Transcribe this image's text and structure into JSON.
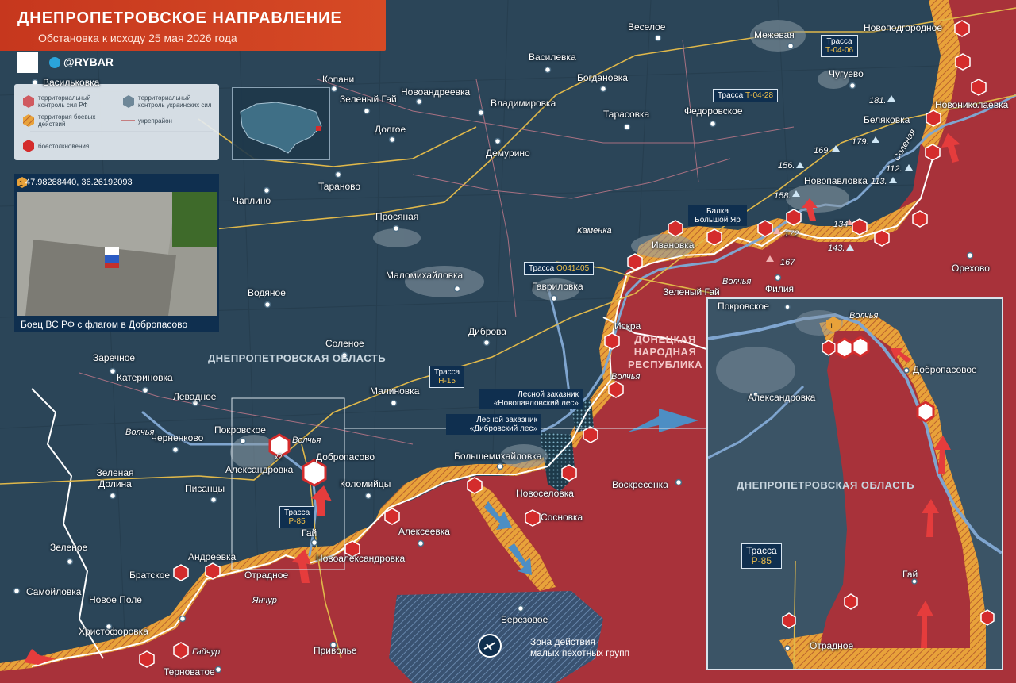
{
  "header": {
    "title": "ДНЕПРОПЕТРОВСКОЕ НАПРАВЛЕНИЕ",
    "subtitle": "Обстановка к исходу 25 мая 2026 года",
    "brand": "@RYBAR"
  },
  "legend": {
    "ru_control": "территориальный контроль сил РФ",
    "ua_control": "территориальный контроль украинских сил",
    "combat_zone": "территория боевых действий",
    "fortified_area": "укрепрайон",
    "clashes": "боестолкновения"
  },
  "photo": {
    "badge": "1",
    "coordinates": "47.98288440, 36.26192093",
    "caption": "Боец ВС РФ с флагом в Добропасово"
  },
  "regions": {
    "dnepr": "ДНЕПРОПЕТРОВСКАЯ ОБЛАСТЬ",
    "dnr": "ДОНЕЦКАЯ НАРОДНАЯ РЕСПУБЛИКА",
    "inset_dnepr": "ДНЕПРОПЕТРОВСКАЯ ОБЛАСТЬ"
  },
  "highways": {
    "t0406": {
      "label": "Трасса",
      "num": "Т-04-06"
    },
    "t0428": {
      "label": "Трасса",
      "num": "Т-04-28"
    },
    "o041405": {
      "label": "Трасса",
      "num": "О041405"
    },
    "h15": {
      "label": "Трасса",
      "num": "Н-15"
    },
    "p85": {
      "label": "Трасса",
      "num": "Р-85"
    },
    "inset_p85": {
      "label": "Трасса",
      "num": "Р-85"
    }
  },
  "tags": {
    "balka": "Балка Большой Яр",
    "forest1": "Лесной заказник «Новопавловский лес»",
    "forest2": "Лесной заказник «Дибровский лес»"
  },
  "zone": {
    "line1": "Зона действия",
    "line2": "малых пехотных групп"
  },
  "multiplier": "x2",
  "rivers": {
    "volchya": "Волчья",
    "kamenka": "Каменка",
    "solenaya": "Соленая",
    "yanchur": "Янчур",
    "gaichur": "Гайчур"
  },
  "heights": [
    "181.",
    "179.",
    "169.",
    "156.",
    "158.",
    "112.",
    "113.",
    "172",
    "134",
    "143.",
    "167"
  ],
  "settlements": {
    "vasilkovka": "Васильковка",
    "kopani": "Копани",
    "zeleny_gai1": "Зеленый Гай",
    "novoandreevka": "Новоандреевка",
    "vladimirovka": "Владимировка",
    "vasilevka": "Василевка",
    "veseloe": "Веселое",
    "bogdanovka": "Богдановка",
    "mezhevaya": "Межевая",
    "novopodgorodnoe": "Новоподгородное",
    "chugueve": "Чугуево",
    "dolgoe": "Долгое",
    "tarasovka": "Тарасовка",
    "fedorovskoe": "Федоровское",
    "novonikolaevka": "Новониколаевка",
    "belyakovka": "Беляковка",
    "demurino": "Демурино",
    "taranovo": "Тараново",
    "novopavlovka": "Новопавловка",
    "chaplino": "Чаплино",
    "prosyanaya": "Просяная",
    "ivanovka": "Ивановка",
    "orehovo": "Орехово",
    "malomikhailovka": "Маломихайловка",
    "gavrilovka": "Гавриловка",
    "zeleny_gai2": "Зеленый Гай",
    "filiya": "Филия",
    "vodyanoe": "Водяное",
    "dibrova": "Диброва",
    "iskra": "Искра",
    "solenoe": "Соленое",
    "zarechnoe": "Заречное",
    "katerinovka": "Катериновка",
    "levadnoe": "Левадное",
    "malinovka": "Малиновка",
    "pokrovskoe": "Покровское",
    "chernenkovo": "Черненково",
    "dobropasovo": "Добропасово",
    "bolshemikhailovka": "Большемихайловка",
    "zelenaya_dolina": "Зеленая Долина",
    "aleksandrovka": "Александровка",
    "kolomiytsy": "Коломийцы",
    "voskresenka": "Воскресенка",
    "pisantsy": "Писанцы",
    "novoselovka": "Новоселовка",
    "sosnovka": "Сосновка",
    "gai": "Гай",
    "alekseevka": "Алексеевка",
    "zelenoe": "Зеленое",
    "andreevka": "Андреевка",
    "novoaleksandrovka": "Новоалександровка",
    "bratskoe": "Братское",
    "otradnoe": "Отрадное",
    "samoilovka": "Самойловка",
    "novoe_pole": "Новое Поле",
    "berezovoe": "Березовое",
    "khristoforovka": "Христофоровка",
    "privolie": "Приволье",
    "ternovatoe": "Терноватое"
  },
  "inset": {
    "badge": "1",
    "pokrovskoe": "Покровское",
    "volchya": "Волчья",
    "dobropasovoe": "Добропасовое",
    "aleksandrovka": "Александровка",
    "gai": "Гай",
    "otradnoe": "Отрадное"
  },
  "colors": {
    "ru_control": "#a8323a",
    "ua_control": "#2b4558",
    "combat": "#e8a23a",
    "title_bg": "#c6371e",
    "river": "#7fa5cf",
    "panel": "#0f2f4f"
  }
}
